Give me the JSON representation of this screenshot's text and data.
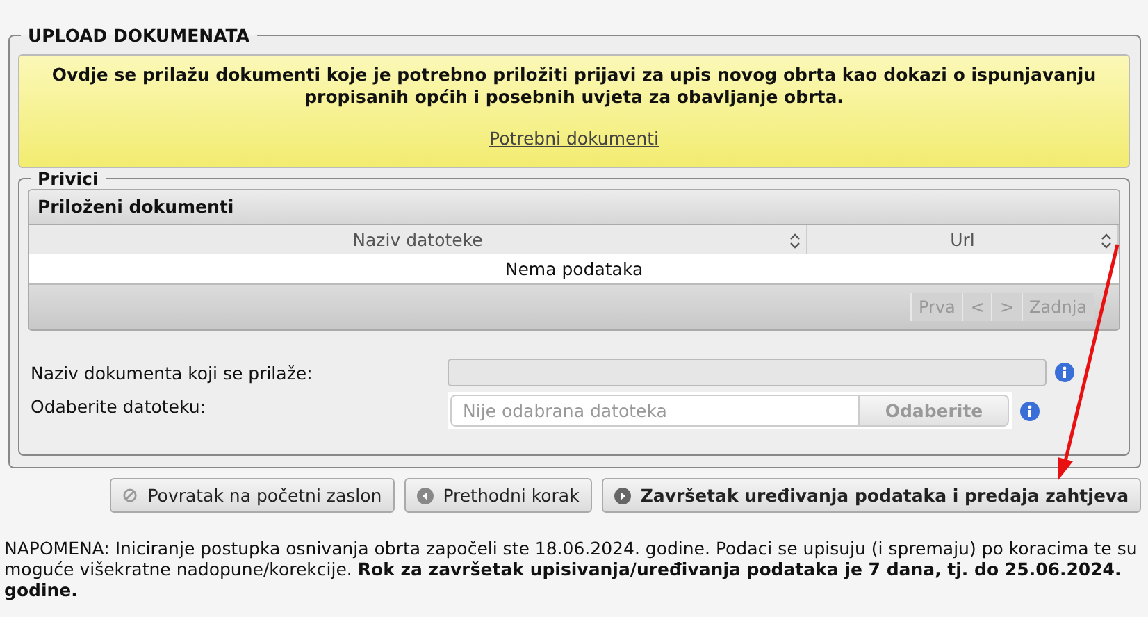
{
  "section": {
    "legend": "UPLOAD DOKUMENATA"
  },
  "notice": {
    "text": "Ovdje se prilažu dokumenti koje je potrebno priložiti prijavi za upis novog obrta kao dokazi o ispunjavanju propisanih općih i posebnih uvjeta za obavljanje obrta.",
    "link": "Potrebni dokumenti"
  },
  "attachments": {
    "legend": "Privici",
    "grid_title": "Priloženi dokumenti",
    "columns": [
      {
        "label": "Naziv datoteke"
      },
      {
        "label": "Url"
      }
    ],
    "empty_text": "Nema podataka",
    "pager": [
      {
        "label": "Prva",
        "disabled": true
      },
      {
        "label": "<",
        "disabled": true
      },
      {
        "label": ">",
        "disabled": true
      },
      {
        "label": "Zadnja",
        "disabled": true
      }
    ]
  },
  "form": {
    "name_label": "Naziv dokumenta koji se prilaže:",
    "name_disabled": true,
    "file_label": "Odaberite datoteku:",
    "file_placeholder": "Nije odabrana datoteka",
    "file_button": "Odaberite"
  },
  "buttons": [
    {
      "label": "Povratak na početni zaslon",
      "kind": "home",
      "primary": false
    },
    {
      "label": "Prethodni korak",
      "kind": "back",
      "primary": false
    },
    {
      "label": "Završetak uređivanja podataka i predaja zahtjeva",
      "kind": "next",
      "primary": true
    }
  ],
  "note": "NAPOMENA: Iniciranje postupka osnivanja obrta započeli ste 18.06.2024. godine. Podaci se upisuju (i spremaju) po koracima te su moguće višekratne nadopune/korekcije. **Rok za završetak upisivanja/uređivanja podataka je 7 dana, tj. do 25.06.2024. godine.**"
}
